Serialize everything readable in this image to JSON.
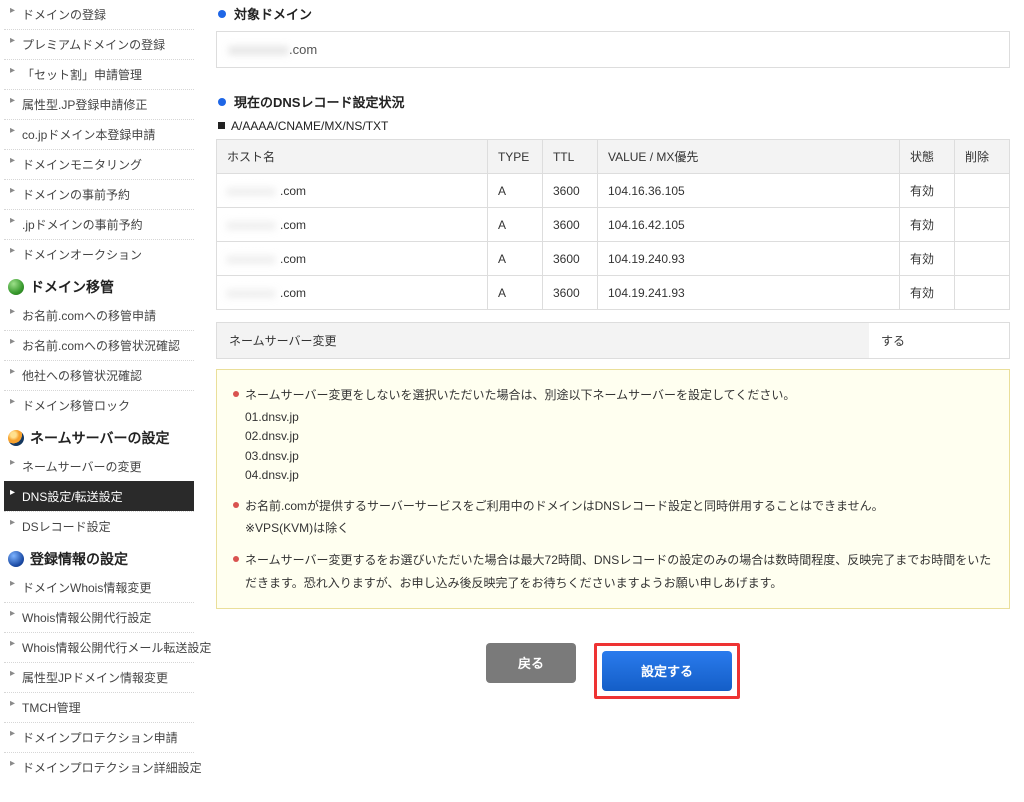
{
  "sidebar": {
    "group1": {
      "items": [
        "ドメインの登録",
        "プレミアムドメインの登録",
        "「セット割」申請管理",
        "属性型.JP登録申請修正",
        "co.jpドメイン本登録申請",
        "ドメインモニタリング",
        "ドメインの事前予約",
        ".jpドメインの事前予約",
        "ドメインオークション"
      ]
    },
    "group2": {
      "title": "ドメイン移管",
      "items": [
        "お名前.comへの移管申請",
        "お名前.comへの移管状況確認",
        "他社への移管状況確認",
        "ドメイン移管ロック"
      ]
    },
    "group3": {
      "title": "ネームサーバーの設定",
      "items": [
        "ネームサーバーの変更",
        "DNS設定/転送設定",
        "DSレコード設定"
      ],
      "active_index": 1
    },
    "group4": {
      "title": "登録情報の設定",
      "items": [
        "ドメインWhois情報変更",
        "Whois情報公開代行設定",
        "Whois情報公開代行メール転送設定",
        "属性型JPドメイン情報変更",
        "TMCH管理",
        "ドメインプロテクション申請",
        "ドメインプロテクション詳細設定"
      ]
    }
  },
  "main": {
    "section1_title": "対象ドメイン",
    "target_domain_suffix": ".com",
    "section2_title": "現在のDNSレコード設定状況",
    "record_types_label": "A/AAAA/CNAME/MX/NS/TXT",
    "table": {
      "head": {
        "host": "ホスト名",
        "type": "TYPE",
        "ttl": "TTL",
        "value": "VALUE / MX優先",
        "state": "状態",
        "delete": "削除"
      },
      "rows": [
        {
          "host_suffix": ".com",
          "type": "A",
          "ttl": "3600",
          "value": "104.16.36.105",
          "state": "有効"
        },
        {
          "host_suffix": ".com",
          "type": "A",
          "ttl": "3600",
          "value": "104.16.42.105",
          "state": "有効"
        },
        {
          "host_suffix": ".com",
          "type": "A",
          "ttl": "3600",
          "value": "104.19.240.93",
          "state": "有効"
        },
        {
          "host_suffix": ".com",
          "type": "A",
          "ttl": "3600",
          "value": "104.19.241.93",
          "state": "有効"
        }
      ]
    },
    "ns_change_label": "ネームサーバー変更",
    "ns_change_value": "する",
    "notice": {
      "item1_head": "ネームサーバー変更をしないを選択いただいた場合は、別途以下ネームサーバーを設定してください。",
      "ns": [
        "01.dnsv.jp",
        "02.dnsv.jp",
        "03.dnsv.jp",
        "04.dnsv.jp"
      ],
      "item2": "お名前.comが提供するサーバーサービスをご利用中のドメインはDNSレコード設定と同時併用することはできません。",
      "item2_sub": "※VPS(KVM)は除く",
      "item3": "ネームサーバー変更するをお選びいただいた場合は最大72時間、DNSレコードの設定のみの場合は数時間程度、反映完了までお時間をいただきます。恐れ入りますが、お申し込み後反映完了をお待ちくださいますようお願い申しあげます。"
    },
    "buttons": {
      "back": "戻る",
      "submit": "設定する"
    }
  }
}
